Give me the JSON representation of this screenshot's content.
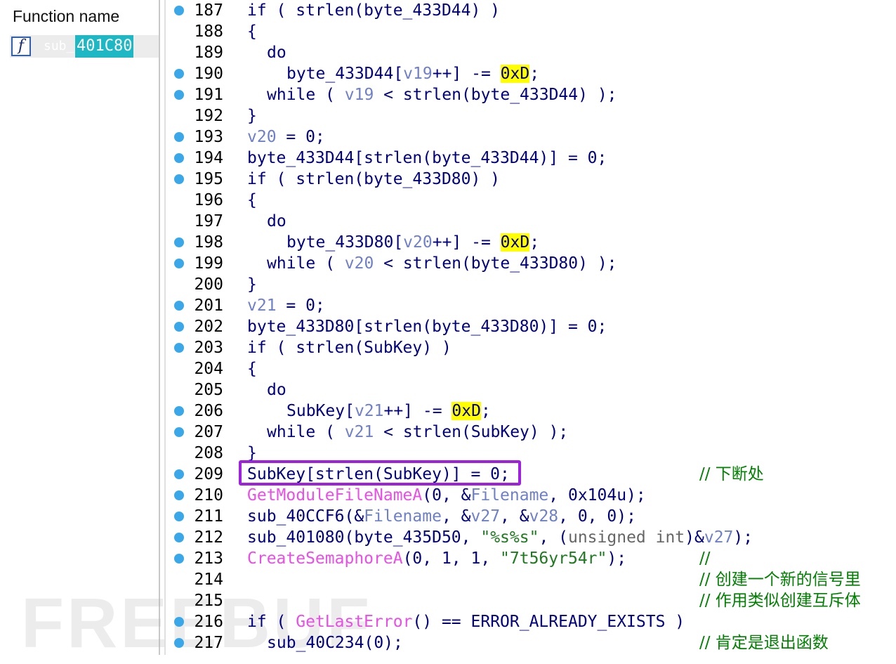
{
  "sidebar": {
    "header": "Function name",
    "item_prefix": "sub_",
    "item_selected": "401C80",
    "item_icon": "function-icon"
  },
  "colors": {
    "code": "#000080",
    "variable": "#6f7fc9",
    "import": "#e94ee6",
    "string": "#1e7a1e",
    "highlight": "#ffff00",
    "breakpoint": "#3aa8e8",
    "box": "#a020e0",
    "comment": "#008000"
  },
  "watermark": "FREEBUF",
  "lines": [
    {
      "n": "187",
      "bp": true,
      "ind": 0,
      "tok": [
        [
          "if ( strlen(byte_433D44) )"
        ]
      ]
    },
    {
      "n": "188",
      "bp": false,
      "ind": 0,
      "tok": [
        [
          "{"
        ]
      ]
    },
    {
      "n": "189",
      "bp": false,
      "ind": 1,
      "tok": [
        [
          "do"
        ]
      ]
    },
    {
      "n": "190",
      "bp": true,
      "ind": 2,
      "tok": [
        [
          "byte_433D44["
        ],
        [
          "v19",
          "v"
        ],
        [
          "++] -= "
        ],
        [
          "0xD",
          "h"
        ],
        [
          ";"
        ]
      ]
    },
    {
      "n": "191",
      "bp": true,
      "ind": 1,
      "tok": [
        [
          "while ( "
        ],
        [
          "v19",
          "v"
        ],
        [
          " < strlen(byte_433D44) );"
        ]
      ]
    },
    {
      "n": "192",
      "bp": false,
      "ind": 0,
      "tok": [
        [
          "}"
        ]
      ]
    },
    {
      "n": "193",
      "bp": true,
      "ind": 0,
      "tok": [
        [
          "v20",
          "v"
        ],
        [
          " = 0;"
        ]
      ]
    },
    {
      "n": "194",
      "bp": true,
      "ind": 0,
      "tok": [
        [
          "byte_433D44[strlen(byte_433D44)] = 0;"
        ]
      ]
    },
    {
      "n": "195",
      "bp": true,
      "ind": 0,
      "tok": [
        [
          "if ( strlen(byte_433D80) )"
        ]
      ]
    },
    {
      "n": "196",
      "bp": false,
      "ind": 0,
      "tok": [
        [
          "{"
        ]
      ]
    },
    {
      "n": "197",
      "bp": false,
      "ind": 1,
      "tok": [
        [
          "do"
        ]
      ]
    },
    {
      "n": "198",
      "bp": true,
      "ind": 2,
      "tok": [
        [
          "byte_433D80["
        ],
        [
          "v20",
          "v"
        ],
        [
          "++] -= "
        ],
        [
          "0xD",
          "h"
        ],
        [
          ";"
        ]
      ]
    },
    {
      "n": "199",
      "bp": true,
      "ind": 1,
      "tok": [
        [
          "while ( "
        ],
        [
          "v20",
          "v"
        ],
        [
          " < strlen(byte_433D80) );"
        ]
      ]
    },
    {
      "n": "200",
      "bp": false,
      "ind": 0,
      "tok": [
        [
          "}"
        ]
      ]
    },
    {
      "n": "201",
      "bp": true,
      "ind": 0,
      "tok": [
        [
          "v21",
          "v"
        ],
        [
          " = 0;"
        ]
      ]
    },
    {
      "n": "202",
      "bp": true,
      "ind": 0,
      "tok": [
        [
          "byte_433D80[strlen(byte_433D80)] = 0;"
        ]
      ]
    },
    {
      "n": "203",
      "bp": true,
      "ind": 0,
      "tok": [
        [
          "if ( strlen(SubKey) )"
        ]
      ]
    },
    {
      "n": "204",
      "bp": false,
      "ind": 0,
      "tok": [
        [
          "{"
        ]
      ]
    },
    {
      "n": "205",
      "bp": false,
      "ind": 1,
      "tok": [
        [
          "do"
        ]
      ]
    },
    {
      "n": "206",
      "bp": true,
      "ind": 2,
      "tok": [
        [
          "SubKey["
        ],
        [
          "v21",
          "v"
        ],
        [
          "++] -= "
        ],
        [
          "0xD",
          "h"
        ],
        [
          ";"
        ]
      ]
    },
    {
      "n": "207",
      "bp": true,
      "ind": 1,
      "tok": [
        [
          "while ( "
        ],
        [
          "v21",
          "v"
        ],
        [
          " < strlen(SubKey) );"
        ]
      ]
    },
    {
      "n": "208",
      "bp": false,
      "ind": 0,
      "tok": [
        [
          "}"
        ]
      ]
    },
    {
      "n": "209",
      "bp": true,
      "ind": 0,
      "tok": [
        [
          "SubKey[strlen(SubKey)] = 0;"
        ]
      ],
      "cmt": "// 下断处"
    },
    {
      "n": "210",
      "bp": true,
      "ind": 0,
      "tok": [
        [
          "GetModuleFileNameA",
          "f"
        ],
        [
          "(0, &"
        ],
        [
          "Filename",
          "v"
        ],
        [
          ", 0x104u);"
        ]
      ]
    },
    {
      "n": "211",
      "bp": true,
      "ind": 0,
      "tok": [
        [
          "sub_40CCF6(&"
        ],
        [
          "Filename",
          "v"
        ],
        [
          ", &"
        ],
        [
          "v27",
          "v"
        ],
        [
          ", &"
        ],
        [
          "v28",
          "v"
        ],
        [
          ", 0, 0);"
        ]
      ]
    },
    {
      "n": "212",
      "bp": true,
      "ind": 0,
      "tok": [
        [
          "sub_401080(byte_435D50, "
        ],
        [
          "\"%s%s\"",
          "s"
        ],
        [
          ", ("
        ],
        [
          "unsigned int",
          "g"
        ],
        [
          ")&"
        ],
        [
          "v27",
          "v"
        ],
        [
          ");"
        ]
      ]
    },
    {
      "n": "213",
      "bp": true,
      "ind": 0,
      "tok": [
        [
          "CreateSemaphoreA",
          "f"
        ],
        [
          "(0, 1, 1, "
        ],
        [
          "\"7t56yr54r\"",
          "s"
        ],
        [
          ");"
        ]
      ],
      "cmt": "//"
    },
    {
      "n": "214",
      "bp": false,
      "ind": 0,
      "tok": [],
      "cmt": "// 创建一个新的信号里"
    },
    {
      "n": "215",
      "bp": false,
      "ind": 0,
      "tok": [],
      "cmt": "// 作用类似创建互斥体"
    },
    {
      "n": "216",
      "bp": true,
      "ind": 0,
      "tok": [
        [
          "if ( "
        ],
        [
          "GetLastError",
          "f"
        ],
        [
          "() == ERROR_ALREADY_EXISTS )"
        ]
      ]
    },
    {
      "n": "217",
      "bp": true,
      "ind": 1,
      "tok": [
        [
          "sub_40C234(0);"
        ]
      ],
      "cmt": "// 肯定是退出函数"
    }
  ]
}
